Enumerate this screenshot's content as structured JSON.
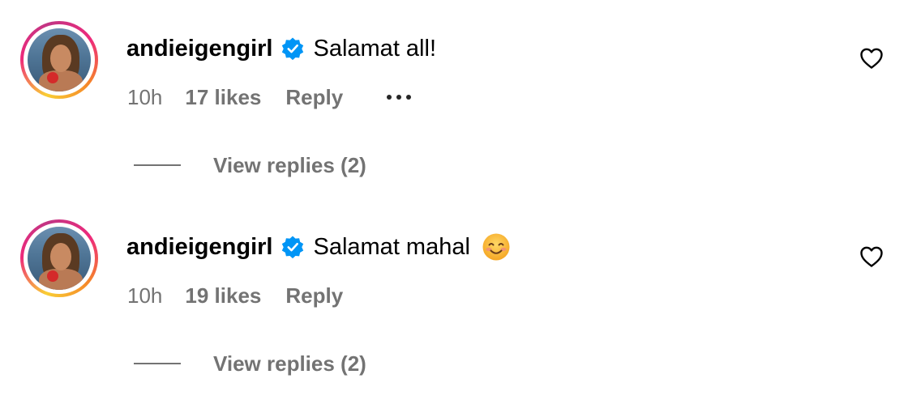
{
  "comments": [
    {
      "username": "andieigengirl",
      "text": "Salamat all!",
      "emoji": "",
      "time": "10h",
      "likes": "17 likes",
      "reply_label": "Reply",
      "view_replies": "View replies (2)",
      "has_more": true
    },
    {
      "username": "andieigengirl",
      "text": "Salamat mahal",
      "emoji": "smiling-face-with-smiling-eyes",
      "time": "10h",
      "likes": "19 likes",
      "reply_label": "Reply",
      "view_replies": "View replies (2)",
      "has_more": false
    }
  ],
  "colors": {
    "verified_badge": "#0095f6",
    "secondary_text": "#737373",
    "primary_text": "#000000",
    "ring_gradient": [
      "#f9ce34",
      "#ee2a7b",
      "#c13584"
    ]
  }
}
